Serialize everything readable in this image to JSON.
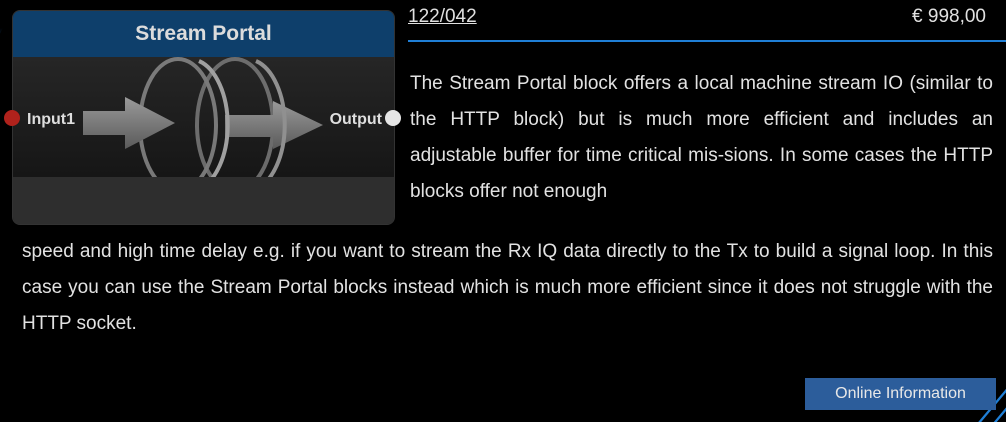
{
  "node": {
    "title": "Stream Portal",
    "input_label": "Input1",
    "output_label": "Output",
    "header_color": "#0e3f6b",
    "input_port_color": "#b0221c",
    "output_port_color": "#e6e6e6"
  },
  "product": {
    "article_number": "122/042",
    "price": "€ 998,00"
  },
  "description": {
    "part1": "The Stream Portal block offers a local machine stream IO (similar to the HTTP block) but is much more efficient and includes an adjustable buffer for time critical mis-sions. In some cases the HTTP blocks offer not enough",
    "part2": "speed and high time delay e.g. if you want to stream the Rx IQ data directly to the Tx to build a signal loop. In this case you can use the Stream Portal blocks instead which is much more efficient since it does not struggle with the HTTP socket."
  },
  "actions": {
    "info_label": "Online Information"
  },
  "colors": {
    "accent": "#1f7fd6",
    "button": "#2c5d9b"
  }
}
